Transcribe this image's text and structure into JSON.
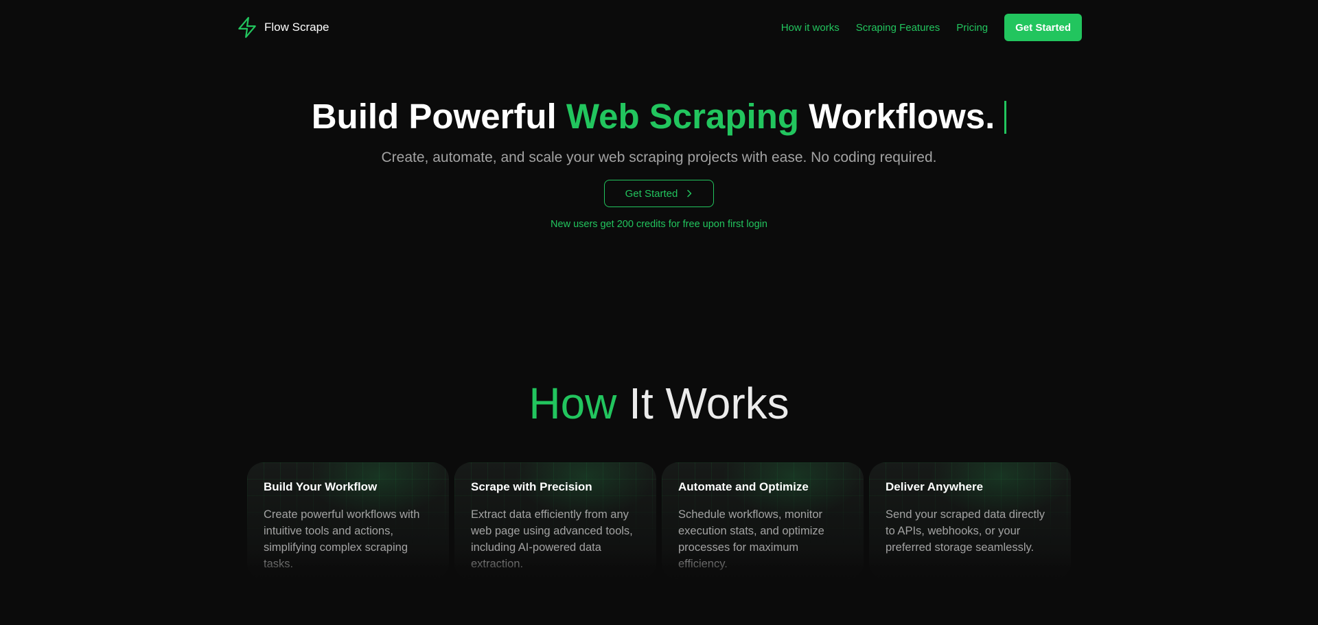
{
  "colors": {
    "accent": "#22c55e",
    "background": "#0b0b0b",
    "muted_text": "#a3a3a3"
  },
  "header": {
    "brand_name": "Flow Scrape",
    "brand_icon": "lightning-bolt-icon",
    "nav": [
      {
        "label": "How it works"
      },
      {
        "label": "Scraping Features"
      },
      {
        "label": "Pricing"
      }
    ],
    "cta_label": "Get Started"
  },
  "hero": {
    "title_part1": "Build Powerful ",
    "title_highlight": "Web Scraping",
    "title_part2": " Workflows.",
    "subtitle": "Create, automate, and scale your web scraping projects with ease. No coding required.",
    "cta_label": "Get Started",
    "cta_icon": "chevron-right-icon",
    "note": "New users get 200 credits for free upon first login"
  },
  "how_it_works": {
    "title_highlight": "How",
    "title_rest": " It Works",
    "cards": [
      {
        "title": "Build Your Workflow",
        "description": "Create powerful workflows with intuitive tools and actions, simplifying complex scraping tasks."
      },
      {
        "title": "Scrape with Precision",
        "description": "Extract data efficiently from any web page using advanced tools, including AI-powered data extraction."
      },
      {
        "title": "Automate and Optimize",
        "description": "Schedule workflows, monitor execution stats, and optimize processes for maximum efficiency."
      },
      {
        "title": "Deliver Anywhere",
        "description": "Send your scraped data directly to APIs, webhooks, or your preferred storage seamlessly."
      }
    ]
  }
}
